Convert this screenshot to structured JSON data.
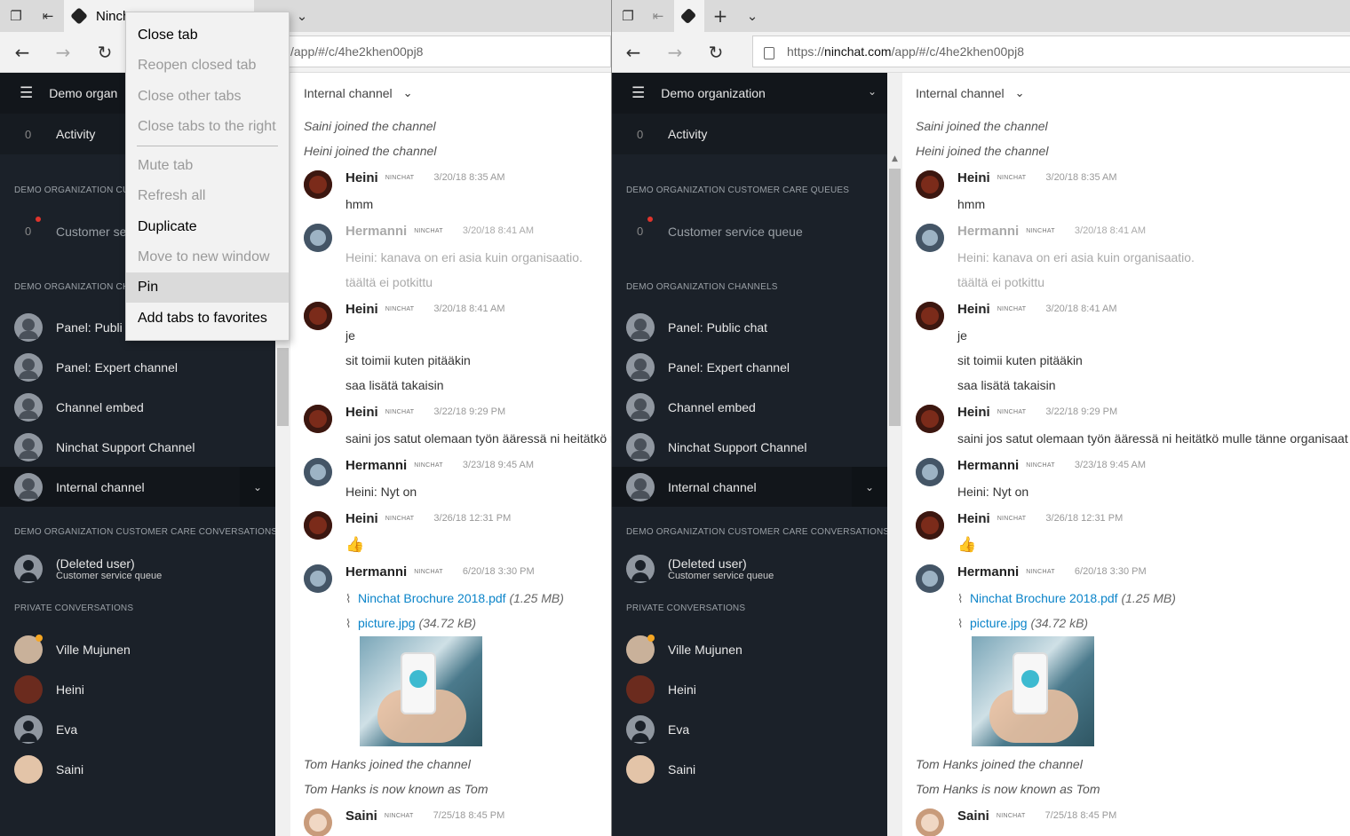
{
  "left": {
    "tab_title": "Ninch",
    "url_tail": "/app/#/c/4he2khen00pj8",
    "org_name": "Demo organ",
    "activity": {
      "count": "0",
      "label": "Activity"
    },
    "queues_header": "DEMO ORGANIZATION CUS",
    "queue": {
      "count": "0",
      "label": "Customer se"
    },
    "channels_header": "DEMO ORGANIZATION CHA",
    "channels": [
      "Panel: Publi",
      "Panel: Expert channel",
      "Channel embed",
      "Ninchat Support Channel",
      "Internal channel"
    ]
  },
  "right": {
    "url_prefix": "https://",
    "url_domain": "ninchat.com",
    "url_path": "/app/#/c/4he2khen00pj8",
    "org_name": "Demo organization",
    "activity": {
      "count": "0",
      "label": "Activity"
    },
    "queues_header": "DEMO ORGANIZATION CUSTOMER CARE QUEUES",
    "queue": {
      "count": "0",
      "label": "Customer service queue"
    },
    "channels_header": "DEMO ORGANIZATION CHANNELS",
    "channels": [
      "Panel: Public chat",
      "Panel: Expert channel",
      "Channel embed",
      "Ninchat Support Channel",
      "Internal channel"
    ]
  },
  "conversations_header": "DEMO ORGANIZATION CUSTOMER CARE CONVERSATIONS",
  "conversation": {
    "name": "(Deleted user)",
    "sub": "Customer service queue"
  },
  "private_header": "PRIVATE CONVERSATIONS",
  "private": [
    "Ville Mujunen",
    "Heini",
    "Eva",
    "Saini"
  ],
  "chat": {
    "title": "Internal channel",
    "sys_top": [
      "Saini joined the channel",
      "Heini joined the channel"
    ],
    "badge": "NINCHAT",
    "m1": {
      "name": "Heini",
      "time": "3/20/18 8:35 AM",
      "lines": [
        "hmm"
      ]
    },
    "m2": {
      "name": "Hermanni",
      "time": "3/20/18 8:41 AM",
      "lines": [
        "Heini: kanava on eri asia kuin organisaatio.",
        "täältä ei potkittu"
      ]
    },
    "m3": {
      "name": "Heini",
      "time": "3/20/18 8:41 AM",
      "lines": [
        "je",
        "sit toimii kuten pitääkin",
        "saa lisätä takaisin"
      ]
    },
    "m4": {
      "name": "Heini",
      "time": "3/22/18 9:29 PM",
      "lines": [
        "saini jos satut olemaan työn ääressä ni heitätkö mulle tänne organisaat"
      ]
    },
    "m5": {
      "name": "Hermanni",
      "time": "3/23/18 9:45 AM",
      "lines": [
        "Heini: Nyt on"
      ]
    },
    "m6": {
      "name": "Heini",
      "time": "3/26/18 12:31 PM",
      "emoji": "👍"
    },
    "m7": {
      "name": "Hermanni",
      "time": "6/20/18 3:30 PM",
      "file1": {
        "name": "Ninchat Brochure 2018.pdf",
        "size": "(1.25 MB)"
      },
      "file2": {
        "name": "picture.jpg",
        "size": "(34.72 kB)"
      }
    },
    "sys_bottom": [
      "Tom Hanks joined the channel",
      "Tom Hanks is now known as Tom"
    ],
    "m8": {
      "name": "Saini",
      "time": "7/25/18 8:45 PM"
    }
  },
  "menu": {
    "close_tab": "Close tab",
    "reopen": "Reopen closed tab",
    "close_other": "Close other tabs",
    "close_right": "Close tabs to the right",
    "mute": "Mute tab",
    "refresh_all": "Refresh all",
    "duplicate": "Duplicate",
    "move": "Move to new window",
    "pin": "Pin",
    "favorites": "Add tabs to favorites"
  }
}
